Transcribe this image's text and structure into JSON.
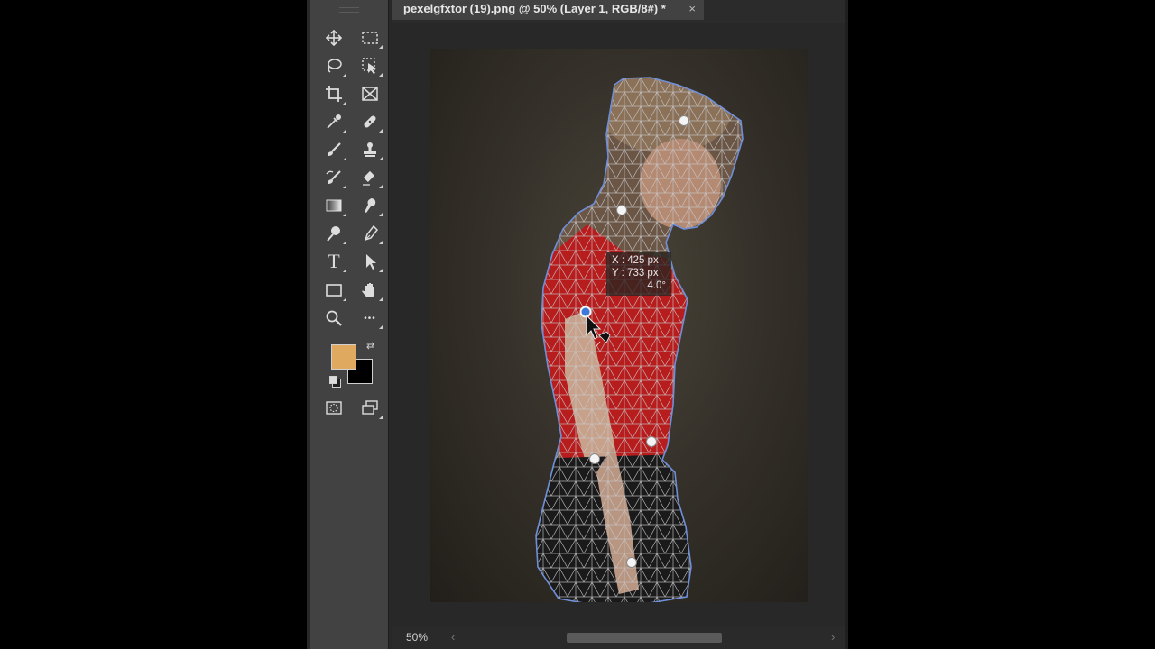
{
  "document": {
    "tab_title": "pexelgfxtor (19).png @ 50% (Layer 1, RGB/8#) *",
    "close_glyph": "×"
  },
  "tools": [
    {
      "name": "move-tool",
      "icon": "move-icon"
    },
    {
      "name": "marquee-tool",
      "icon": "rectangular-marquee-icon"
    },
    {
      "name": "lasso-tool",
      "icon": "lasso-icon"
    },
    {
      "name": "object-selection-tool",
      "icon": "object-selection-icon"
    },
    {
      "name": "crop-tool",
      "icon": "crop-icon"
    },
    {
      "name": "frame-tool",
      "icon": "frame-icon"
    },
    {
      "name": "eyedropper-tool",
      "icon": "eyedropper-icon"
    },
    {
      "name": "healing-tool",
      "icon": "bandage-icon"
    },
    {
      "name": "brush-tool",
      "icon": "brush-icon"
    },
    {
      "name": "clone-stamp-tool",
      "icon": "stamp-icon"
    },
    {
      "name": "history-brush-tool",
      "icon": "history-brush-icon"
    },
    {
      "name": "eraser-tool",
      "icon": "eraser-icon"
    },
    {
      "name": "gradient-tool",
      "icon": "gradient-icon"
    },
    {
      "name": "smudge-tool",
      "icon": "smudge-icon"
    },
    {
      "name": "dodge-tool",
      "icon": "dodge-icon"
    },
    {
      "name": "pen-tool",
      "icon": "pen-icon"
    },
    {
      "name": "type-tool",
      "icon": "type-icon"
    },
    {
      "name": "path-selection-tool",
      "icon": "arrow-icon"
    },
    {
      "name": "rectangle-tool",
      "icon": "rectangle-icon"
    },
    {
      "name": "hand-tool",
      "icon": "hand-icon"
    },
    {
      "name": "zoom-tool",
      "icon": "magnifier-icon"
    },
    {
      "name": "more-tools",
      "icon": "ellipsis-icon"
    }
  ],
  "type_tool_glyph": "T",
  "more_glyph": "•••",
  "colors": {
    "foreground": "#e0a960",
    "background": "#000000",
    "swap_glyph": "⇄",
    "mesh_outline": "#6f8fd8",
    "shirt": "#b81d1d"
  },
  "readout": {
    "x_line": "X : 425 px",
    "y_line": "Y : 733 px",
    "angle_line": "4.0°"
  },
  "status": {
    "zoom": "50%",
    "scroll_left_glyph": "‹",
    "scroll_right_glyph": "›"
  }
}
